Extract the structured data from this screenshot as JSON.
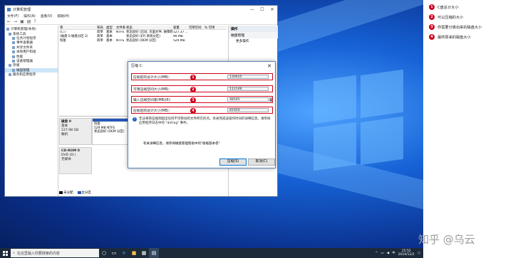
{
  "window": {
    "title": "计算机管理",
    "menu": [
      "文件(F)",
      "操作(A)",
      "查看(V)",
      "帮助(H)"
    ],
    "controls": [
      "—",
      "☐",
      "✕"
    ]
  },
  "tree": [
    "计算机管理(本地)",
    "系统工具",
    "任务计划程序",
    "事件查看器",
    "共享文件夹",
    "本地用户和组",
    "性能",
    "设备管理器",
    "存储",
    "磁盘管理",
    "服务和应用程序"
  ],
  "volume_table": {
    "headers": [
      "卷",
      "布局",
      "类型",
      "文件系统",
      "状态",
      "容量",
      "可用空间",
      "% 可用"
    ],
    "rows": [
      [
        "(C:)",
        "简单",
        "基本",
        "NTFS",
        "状态良好 (启动, 页面文件, 故障转储, 主分区)",
        "127.37 ...",
        "",
        ""
      ],
      [
        "(磁盘 0 磁盘分区 2)",
        "简单",
        "基本",
        "",
        "状态良好 (EFI 系统分区)",
        "99 MB",
        "",
        ""
      ],
      [
        "恢复",
        "简单",
        "基本",
        "NTFS",
        "状态良好 (OEM 分区)",
        "529 MB",
        "",
        ""
      ]
    ]
  },
  "disks": [
    {
      "name": "磁盘 0",
      "type": "基本",
      "size": "127.98 GB",
      "status": "联机",
      "partitions": [
        {
          "name": "恢复",
          "line2": "529 MB NTFS",
          "line3": "状态良好 (OEM 分区)"
        },
        {
          "name": "",
          "line2": "99 MB",
          "line3": "状态良好 (E"
        },
        {
          "name": "(C:)",
          "line2": "",
          "line3": ""
        }
      ]
    },
    {
      "name": "CD-ROM 0",
      "type": "DVD (D:)",
      "size": "",
      "status": "无媒体",
      "partitions": []
    }
  ],
  "legend": {
    "unallocated": "未分配",
    "primary": "主分区"
  },
  "actions": {
    "title": "操作",
    "section": "磁盘管理",
    "item": "更多操作"
  },
  "dialog": {
    "title": "压缩 C:",
    "rows": [
      {
        "label": "压缩前的总计大小(MB):",
        "value": "130425",
        "badge": "1"
      },
      {
        "label": "可用压缩空间大小(MB):",
        "value": "112146",
        "badge": "2"
      },
      {
        "label": "输入压缩空间量(MB)(E):",
        "value": "48505",
        "badge": "3"
      },
      {
        "label": "压缩后的总计大小(MB):",
        "value": "81920",
        "badge": "4"
      }
    ],
    "info": "无法将卷压缩到超出任何不可移动的文件所在的点。有关完成该操作时间的详细信息，请参阅应用程序日志中的 \"defrag\" 事件。",
    "more": "有关详细信息，请参阅磁盘管理帮助中的\"收缩基本卷\"",
    "shrink_label": "压缩(S)",
    "cancel_label": "取消(C)"
  },
  "taskbar": {
    "search_placeholder": "在这里输入你要搜索的内容",
    "time": "15:52",
    "date": "2019/12/2"
  },
  "notes": [
    {
      "badge": "1",
      "text": "C盘总计大小"
    },
    {
      "badge": "2",
      "text": "可以压缩的大小"
    },
    {
      "badge": "3",
      "text": "你需要分离出来的磁盘大小"
    },
    {
      "badge": "4",
      "text": "最终原来的磁盘大小"
    }
  ],
  "watermark": "知乎 @乌云",
  "colors": {
    "annotation": "#d0021b",
    "partition_bar": "#2657b5",
    "unallocated": "#111111"
  }
}
